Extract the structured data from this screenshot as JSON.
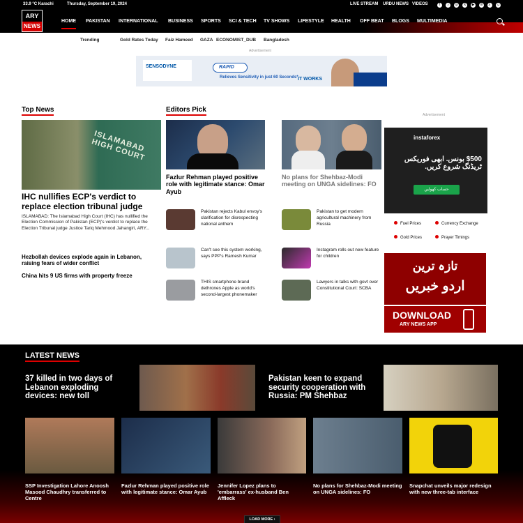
{
  "header": {
    "logo_top": "ARY",
    "logo_bottom": "NEWS",
    "weather": "33.9 °C Karachi",
    "date": "Thursday, September 19, 2024",
    "top_links": [
      "LIVE STREAM",
      "URDU NEWS",
      "VIDEOS"
    ],
    "social": [
      "f",
      "♪",
      "◎",
      "X",
      "▶",
      "in",
      "♬",
      "☺"
    ],
    "nav": [
      "HOME",
      "PAKISTAN",
      "INTERNATIONAL",
      "BUSINESS",
      "SPORTS",
      "SCI & TECH",
      "TV SHOWS",
      "LIFESTYLE",
      "HEALTH",
      "OFF BEAT",
      "BLOGS",
      "MULTIMEDIA"
    ]
  },
  "trending": {
    "label": "Trending",
    "items": [
      "Gold Rates Today",
      "Faiz Hameed",
      "GAZA",
      "ECONOMIST_DUB",
      "Bangladesh"
    ]
  },
  "ad": {
    "label": "Advertisement",
    "sensodyne": "SENSODYNE",
    "rapid": "RAPID",
    "relieves": "Relieves Sensitivity in just 60 Seconds*",
    "it_works": "IT WORKS"
  },
  "top_news": {
    "title": "Top News",
    "headline": "IHC nullifies ECP's verdict to replace election tribunal judge",
    "excerpt": "ISLAMABAD: The Islamabad High Court (IHC) has nullified the Election Commission of Pakistan (ECP)'s verdict to replace the Election Tribunal judge Justice Tariq Mehmood Jahangiri, ARY...",
    "image_text": "ISLAMABAD HIGH COURT",
    "more": [
      "Hezbollah devices explode again in Lebanon, raising fears of wider conflict",
      "China hits 9 US firms with property freeze"
    ]
  },
  "editors_pick": {
    "title": "Editors Pick",
    "main_headline": "Fazlur Rehman played positive role with legitimate stance: Omar Ayub",
    "second_headline": "No plans for Shehbaz-Modi meeting on UNGA sidelines: FO",
    "left_items": [
      "Pakistan rejects Kabul envoy's clarification for disrespecting national anthem",
      "Can't see this system working, says PPP's Ramesh Kumar",
      "THIS smartphone brand dethrones Apple as world's second-largest phonemaker"
    ],
    "right_items": [
      "Pakistan to get modern agricultural machinery from Russia",
      "Instagram rolls out new feature for children",
      "Lawyers in talks with govt over Constitutional Court: SCBA"
    ]
  },
  "sidebar": {
    "ad_label": "Advertisement",
    "instaforex": "instaforex",
    "ad_urdu": "$500 بونس. ابھی فوریکس ٹریڈنگ شروع کریں.",
    "ad_button": "حساب کھولیں",
    "market": [
      "Fuel Prices",
      "Currency Exchange",
      "Gold Prices",
      "Prayer Timings"
    ],
    "urdu_line1": "تازہ ترین",
    "urdu_line2": "اردو خبریں",
    "download": "DOWNLOAD",
    "app": "ARY NEWS APP"
  },
  "latest": {
    "title": "LATEST NEWS",
    "big1": "37 killed in two days of Lebanon exploding devices: new toll",
    "big2": "Pakistan keen to expand security cooperation with Russia: PM Shehbaz",
    "cards": [
      "SSP Investigation Lahore Anoosh Masood Chaudhry transferred to Centre",
      "Fazlur Rehman played positive role with legitimate stance: Omar Ayub",
      "Jennifer Lopez plans to 'embarrass' ex-husband Ben Affleck",
      "No plans for Shehbaz-Modi meeting on UNGA sidelines: FO",
      "Snapchat unveils major redesign with new three-tab interface"
    ],
    "load_more": "LOAD MORE ›"
  }
}
